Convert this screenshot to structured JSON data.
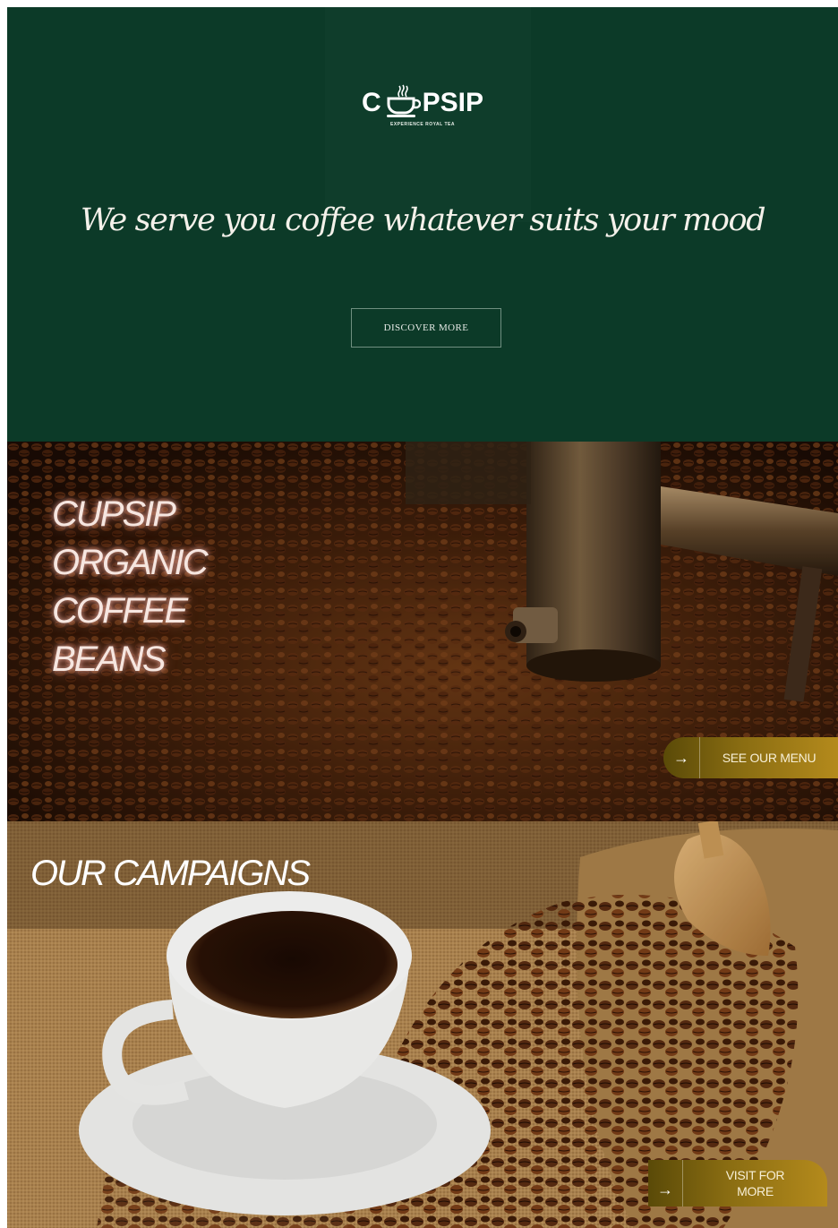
{
  "hero": {
    "logo_left": "C",
    "logo_right": "PSIP",
    "logo_tagline": "EXPERIENCE ROYAL TEA",
    "logo_icon": "coffee-cup-icon",
    "headline": "We serve you coffee whatever suits your mood",
    "cta_label": "DISCOVER MORE"
  },
  "beans_section": {
    "title_lines": [
      "CUPSIP",
      "ORGANIC",
      "COFFEE",
      "BEANS"
    ],
    "menu_button": {
      "arrow": "→",
      "label": "SEE OUR MENU"
    }
  },
  "campaigns_section": {
    "title": "OUR CAMPAIGNS",
    "visit_button": {
      "arrow": "→",
      "label_line1": "VISIT FOR",
      "label_line2": "MORE"
    }
  },
  "colors": {
    "hero_green": "#0c3a28",
    "gold_gradient_start": "#5a4a08",
    "gold_gradient_end": "#b48a1c",
    "neon_pink": "#f6e6e0"
  }
}
